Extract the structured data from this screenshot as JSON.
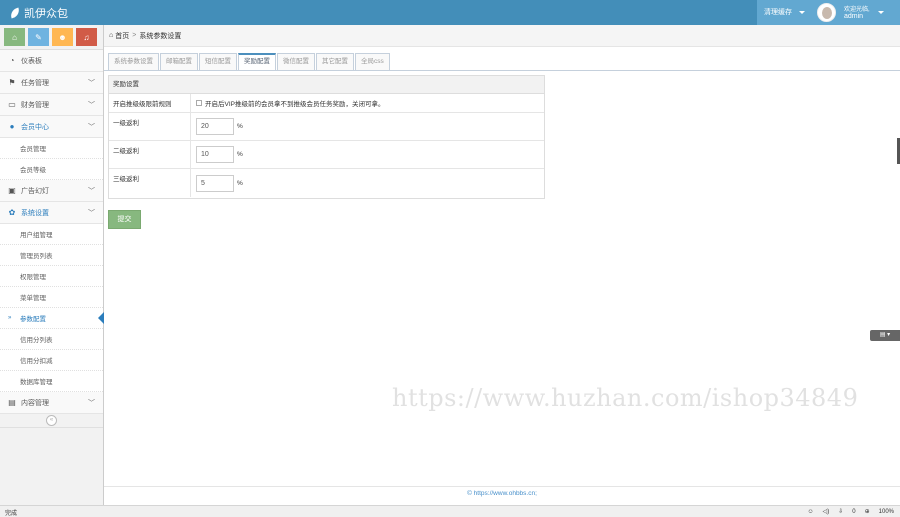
{
  "app": {
    "brand": "凯伊众包",
    "cache_label": "清理缓存",
    "welcome": "欢迎光临,",
    "username": "admin"
  },
  "shortcuts": [
    {
      "icon": "home-icon",
      "glyph": "⌂"
    },
    {
      "icon": "pencil-icon",
      "glyph": "✎"
    },
    {
      "icon": "group-icon",
      "glyph": "☻"
    },
    {
      "icon": "bell-icon",
      "glyph": "♫"
    }
  ],
  "sidebar": {
    "dashboard": "仪表板",
    "task_mgmt": "任务管理",
    "finance_mgmt": "财务管理",
    "member_center": "会员中心",
    "member_mgmt": "会员管理",
    "member_level": "会员等级",
    "ads": "广告幻灯",
    "system_settings": "系统设置",
    "user_group_mgmt": "用户组管理",
    "admin_list": "管理员列表",
    "permission_mgmt": "权限管理",
    "menu_mgmt": "菜单管理",
    "param_config": "参数配置",
    "credit_list": "信用分列表",
    "credit_deduct": "信用分扣减",
    "db_mgmt": "数据库管理",
    "content_mgmt": "内容管理",
    "collapse": "«"
  },
  "breadcrumb": {
    "home": "首页",
    "sep": ">",
    "current": "系统参数设置"
  },
  "tabs": [
    "系统参数设置",
    "邮箱配置",
    "短信配置",
    "奖励配置",
    "微信配置",
    "其它配置",
    "全局css"
  ],
  "panel": {
    "title": "奖励设置",
    "rows": [
      {
        "label": "开启推级级限前规则",
        "checkbox_text": "开启后VIP推级前的会员拿不到推级会员任务奖励，关闭可拿。"
      },
      {
        "label": "一级返利",
        "value": "20",
        "unit": "%"
      },
      {
        "label": "二级返利",
        "value": "10",
        "unit": "%"
      },
      {
        "label": "三级返利",
        "value": "5",
        "unit": "%"
      }
    ]
  },
  "submit_label": "提交",
  "footer": "© https://www.ohbbs.cn;",
  "watermark": "https://www.huzhan.com/ishop34849",
  "statusbar": {
    "done": "完成",
    "zoom": "100%",
    "count0": "0"
  },
  "colors": {
    "topbar": "#438eb9",
    "accent": "#2b7dbc",
    "submit": "#87b87f"
  }
}
